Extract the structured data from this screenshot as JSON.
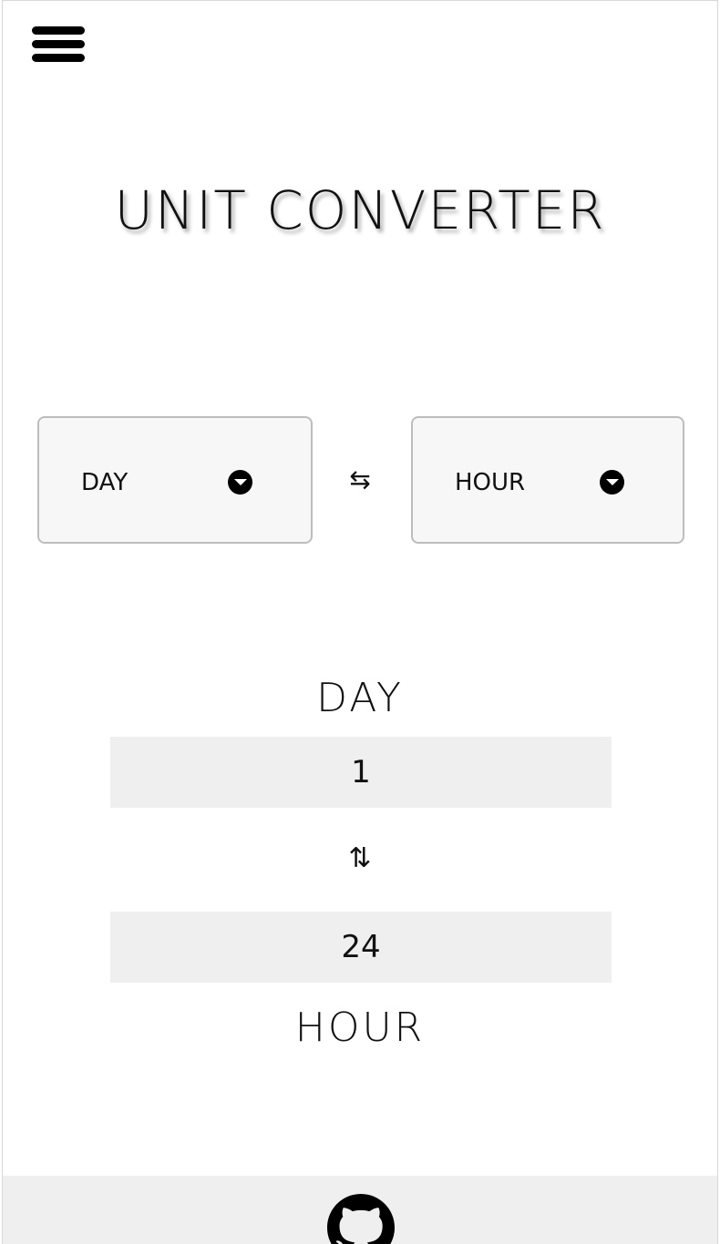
{
  "header": {
    "menu_icon": "hamburger-menu-icon",
    "title": "UNIT CONVERTER"
  },
  "selectors": {
    "from_unit": "DAY",
    "to_unit": "HOUR",
    "caret_icon": "caret-down-circle-icon",
    "swap_icon": "swap-horizontal-icon",
    "swap_symbol": "⇆"
  },
  "converter": {
    "from_label": "DAY",
    "from_value": "1",
    "swap_icon": "swap-vertical-icon",
    "swap_symbol": "⇅",
    "to_value": "24",
    "to_label": "HOUR"
  },
  "footer": {
    "github_icon": "github-icon"
  }
}
